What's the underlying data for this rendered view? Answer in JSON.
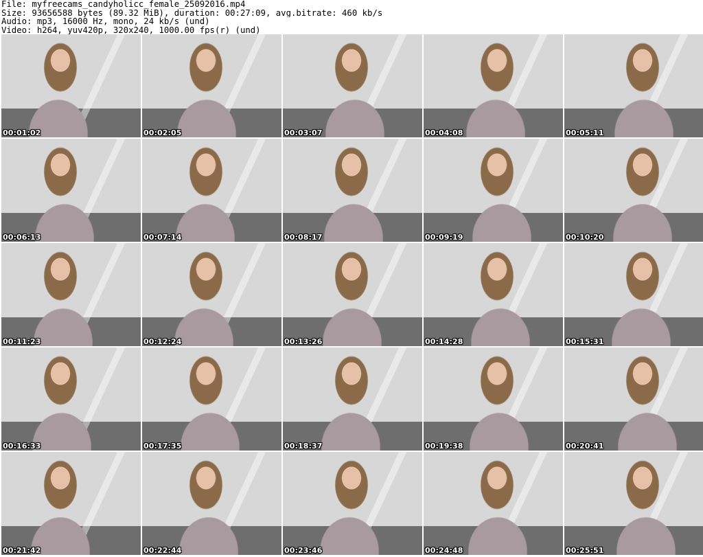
{
  "header": {
    "file_line": "File: myfreecams_candyholicc_female_25092016.mp4",
    "size_line": "Size: 93656588 bytes (89.32 MiB), duration: 00:27:09, avg.bitrate: 460 kb/s",
    "audio_line": "Audio: mp3, 16000 Hz, mono, 24 kb/s (und)",
    "video_line": "Video: h264, yuv420p, 320x240, 1000.00 fps(r) (und)"
  },
  "thumbnails": [
    {
      "timestamp": "00:01:02"
    },
    {
      "timestamp": "00:02:05"
    },
    {
      "timestamp": "00:03:07"
    },
    {
      "timestamp": "00:04:08"
    },
    {
      "timestamp": "00:05:11"
    },
    {
      "timestamp": "00:06:13"
    },
    {
      "timestamp": "00:07:14"
    },
    {
      "timestamp": "00:08:17"
    },
    {
      "timestamp": "00:09:19"
    },
    {
      "timestamp": "00:10:20"
    },
    {
      "timestamp": "00:11:23"
    },
    {
      "timestamp": "00:12:24"
    },
    {
      "timestamp": "00:13:26"
    },
    {
      "timestamp": "00:14:28"
    },
    {
      "timestamp": "00:15:31"
    },
    {
      "timestamp": "00:16:33"
    },
    {
      "timestamp": "00:17:35"
    },
    {
      "timestamp": "00:18:37"
    },
    {
      "timestamp": "00:19:38"
    },
    {
      "timestamp": "00:20:41"
    },
    {
      "timestamp": "00:21:42"
    },
    {
      "timestamp": "00:22:44"
    },
    {
      "timestamp": "00:23:46"
    },
    {
      "timestamp": "00:24:48"
    },
    {
      "timestamp": "00:25:51"
    }
  ],
  "colors": {
    "background": "#ffffff",
    "text": "#000000",
    "wall": "#d7d7d7",
    "floor": "#6e6e6e",
    "dress": "#a89a9f",
    "hair": "#8a6a48",
    "skin": "#e7c0a8"
  }
}
